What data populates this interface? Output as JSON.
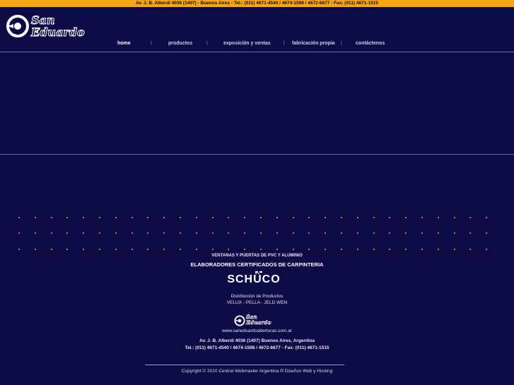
{
  "topbar": {
    "contact": "Av. J. B. Alberdi 4036 (1407) - Buenos Aires - Tel.: (011) 4671-4540 / 4674-1598 / 4672-6677 - Fax: (011) 4671-1515"
  },
  "logo": {
    "line1": "San",
    "line2": "Eduardo"
  },
  "nav": {
    "items": [
      {
        "label": "home",
        "active": true
      },
      {
        "label": "productos"
      },
      {
        "label": "exposición y ventas"
      },
      {
        "label": "fabricación propia"
      },
      {
        "label": "contáctenos"
      }
    ],
    "separator": "|"
  },
  "footer": {
    "tagline": "VENTANAS Y PUERTAS DE PVC Y ALUMINIO",
    "certified": "ELABORADORES CERTIFICADOS DE CARPINTERIA",
    "brand": "SCHÜCO",
    "distribution_title": "Distribución de Productos",
    "distribution_brands": "VELUX - PELLA - JELD WEN",
    "small_logo_line1": "San",
    "small_logo_line2": "Eduardo",
    "website": "www.saneduardoaberturas.com.ar",
    "address": "Av. J. B. Alberdi 4036 (1407) Buenos Aires, Argentina",
    "phones": "Tel.: (011) 4671-4540 / 4674-1598 / 4672-6677 - Fax: (011) 4671-1515",
    "copyright": "Copyright © 2010 Central Webmaster Argentina ® Diseños Web y Hosting"
  },
  "colors": {
    "background": "#0c0b45",
    "accent": "#f5a513"
  }
}
